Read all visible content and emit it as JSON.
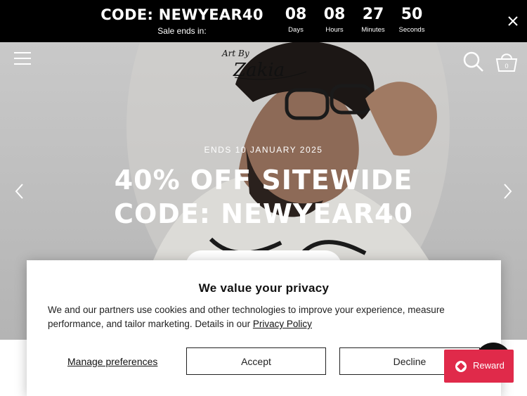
{
  "announcement": {
    "code_text": "CODE: NEWYEAR40",
    "sale_text": "Sale ends in:",
    "countdown": [
      {
        "value": "08",
        "label": "Days"
      },
      {
        "value": "08",
        "label": "Hours"
      },
      {
        "value": "27",
        "label": "Minutes"
      },
      {
        "value": "50",
        "label": "Seconds"
      }
    ],
    "close_icon": "close-icon"
  },
  "header": {
    "logo_line1": "Art By",
    "logo_line2": "Zakia",
    "icons": [
      "menu-icon",
      "search-icon",
      "cart-icon"
    ],
    "cart_count": "0"
  },
  "hero": {
    "ends_text": "ENDS 10 JANUARY 2025",
    "headline_1": "40% OFF SITEWIDE",
    "headline_2": "CODE: NEWYEAR40",
    "prev_icon": "chevron-left-icon",
    "next_icon": "chevron-right-icon"
  },
  "privacy": {
    "title": "We value your privacy",
    "body": "We and our partners use cookies and other technologies to improve your experience, measure performance, and tailor marketing. Details in our ",
    "policy_link": "Privacy Policy",
    "manage_label": "Manage preferences",
    "accept_label": "Accept",
    "decline_label": "Decline"
  },
  "widgets": {
    "reward_label": "Reward",
    "reward_icon": "reward-icon",
    "brand_color": "#e02a4a"
  }
}
